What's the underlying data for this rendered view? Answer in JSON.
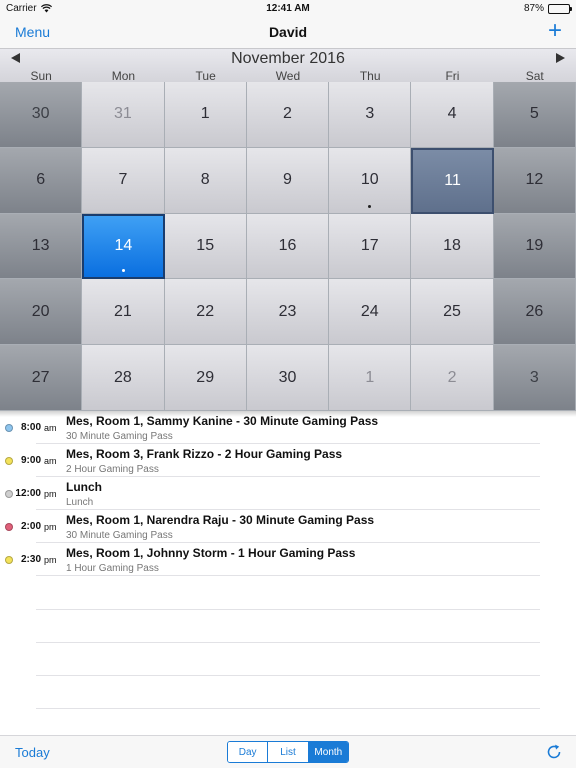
{
  "status_bar": {
    "carrier": "Carrier",
    "time": "12:41 AM",
    "battery": "87%",
    "battery_level": 0.87
  },
  "nav": {
    "menu_label": "Menu",
    "title": "David",
    "add_label": "+"
  },
  "calendar": {
    "month_title": "November 2016",
    "weekdays": [
      "Sun",
      "Mon",
      "Tue",
      "Wed",
      "Thu",
      "Fri",
      "Sat"
    ],
    "weeks": [
      [
        {
          "day": "30",
          "other": true
        },
        {
          "day": "31",
          "other": true
        },
        {
          "day": "1"
        },
        {
          "day": "2"
        },
        {
          "day": "3"
        },
        {
          "day": "4"
        },
        {
          "day": "5"
        }
      ],
      [
        {
          "day": "6"
        },
        {
          "day": "7"
        },
        {
          "day": "8"
        },
        {
          "day": "9"
        },
        {
          "day": "10",
          "dot": true
        },
        {
          "day": "11",
          "selected": true
        },
        {
          "day": "12"
        }
      ],
      [
        {
          "day": "13"
        },
        {
          "day": "14",
          "today": true,
          "dot": true
        },
        {
          "day": "15"
        },
        {
          "day": "16"
        },
        {
          "day": "17"
        },
        {
          "day": "18"
        },
        {
          "day": "19"
        }
      ],
      [
        {
          "day": "20"
        },
        {
          "day": "21"
        },
        {
          "day": "22"
        },
        {
          "day": "23"
        },
        {
          "day": "24"
        },
        {
          "day": "25"
        },
        {
          "day": "26"
        }
      ],
      [
        {
          "day": "27"
        },
        {
          "day": "28"
        },
        {
          "day": "29"
        },
        {
          "day": "30"
        },
        {
          "day": "1",
          "other": true
        },
        {
          "day": "2",
          "other": true
        },
        {
          "day": "3",
          "other": true
        }
      ]
    ]
  },
  "events": [
    {
      "time": "8:00",
      "ampm": "am",
      "title": "Mes, Room 1, Sammy Kanine - 30 Minute Gaming Pass",
      "subtitle": "30 Minute Gaming Pass",
      "color": "#8ec5ee"
    },
    {
      "time": "9:00",
      "ampm": "am",
      "title": "Mes, Room 3, Frank Rizzo - 2 Hour Gaming Pass",
      "subtitle": "2 Hour Gaming Pass",
      "color": "#f3e25a"
    },
    {
      "time": "12:00",
      "ampm": "pm",
      "title": "Lunch",
      "subtitle": "Lunch",
      "color": "#cfcfcf"
    },
    {
      "time": "2:00",
      "ampm": "pm",
      "title": "Mes, Room 1, Narendra Raju - 30 Minute Gaming Pass",
      "subtitle": "30 Minute Gaming Pass",
      "color": "#e0607a"
    },
    {
      "time": "2:30",
      "ampm": "pm",
      "title": "Mes, Room 1, Johnny Storm - 1 Hour Gaming Pass",
      "subtitle": "1 Hour Gaming Pass",
      "color": "#f3e25a"
    }
  ],
  "toolbar": {
    "today_label": "Today",
    "views": [
      {
        "label": "Day",
        "active": false
      },
      {
        "label": "List",
        "active": false
      },
      {
        "label": "Month",
        "active": true
      }
    ],
    "refresh_icon": "refresh-icon"
  },
  "colors": {
    "accent": "#1a7bd6",
    "today": "#0a6fe0",
    "selected": "#6f809c"
  }
}
